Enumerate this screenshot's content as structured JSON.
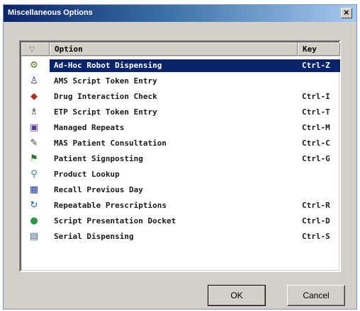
{
  "window": {
    "title": "Miscellaneous Options"
  },
  "table": {
    "columns": {
      "icon": "▽",
      "option": "Option",
      "key": "Key"
    },
    "rows": [
      {
        "icon": "robot-icon",
        "glyph": "⚙",
        "color": "#4c7a1c",
        "option": "Ad-Hoc Robot Dispensing",
        "key": "Ctrl-Z",
        "selected": true
      },
      {
        "icon": "people-icon",
        "glyph": "♙",
        "color": "#1c3aa0",
        "option": "AMS Script Token Entry",
        "key": "",
        "selected": false
      },
      {
        "icon": "drug-interaction-icon",
        "glyph": "◆",
        "color": "#b03020",
        "option": "Drug Interaction Check",
        "key": "Ctrl-I",
        "selected": false
      },
      {
        "icon": "etp-token-icon",
        "glyph": "♗",
        "color": "#303030",
        "option": "ETP Script Token Entry",
        "key": "Ctrl-T",
        "selected": false
      },
      {
        "icon": "repeats-icon",
        "glyph": "▣",
        "color": "#5a3aa0",
        "option": "Managed Repeats",
        "key": "Ctrl-M",
        "selected": false
      },
      {
        "icon": "consultation-icon",
        "glyph": "✎",
        "color": "#404040",
        "option": "MAS Patient Consultation",
        "key": "Ctrl-C",
        "selected": false
      },
      {
        "icon": "signpost-icon",
        "glyph": "⚑",
        "color": "#2a7a2a",
        "option": "Patient Signposting",
        "key": "Ctrl-G",
        "selected": false
      },
      {
        "icon": "lookup-icon",
        "glyph": "⚲",
        "color": "#3a7a8a",
        "option": "Product Lookup",
        "key": "",
        "selected": false
      },
      {
        "icon": "calendar-icon",
        "glyph": "▦",
        "color": "#1c3aa0",
        "option": "Recall Previous Day",
        "key": "",
        "selected": false
      },
      {
        "icon": "refresh-icon",
        "glyph": "↻",
        "color": "#1c5ac8",
        "option": "Repeatable Prescriptions",
        "key": "Ctrl-R",
        "selected": false
      },
      {
        "icon": "docket-icon",
        "glyph": "●",
        "color": "#2a9a4a",
        "option": "Script Presentation Docket",
        "key": "Ctrl-D",
        "selected": false
      },
      {
        "icon": "serial-icon",
        "glyph": "▤",
        "color": "#3a5a9a",
        "option": "Serial Dispensing",
        "key": "Ctrl-S",
        "selected": false
      }
    ]
  },
  "buttons": {
    "ok": "OK",
    "cancel": "Cancel"
  }
}
